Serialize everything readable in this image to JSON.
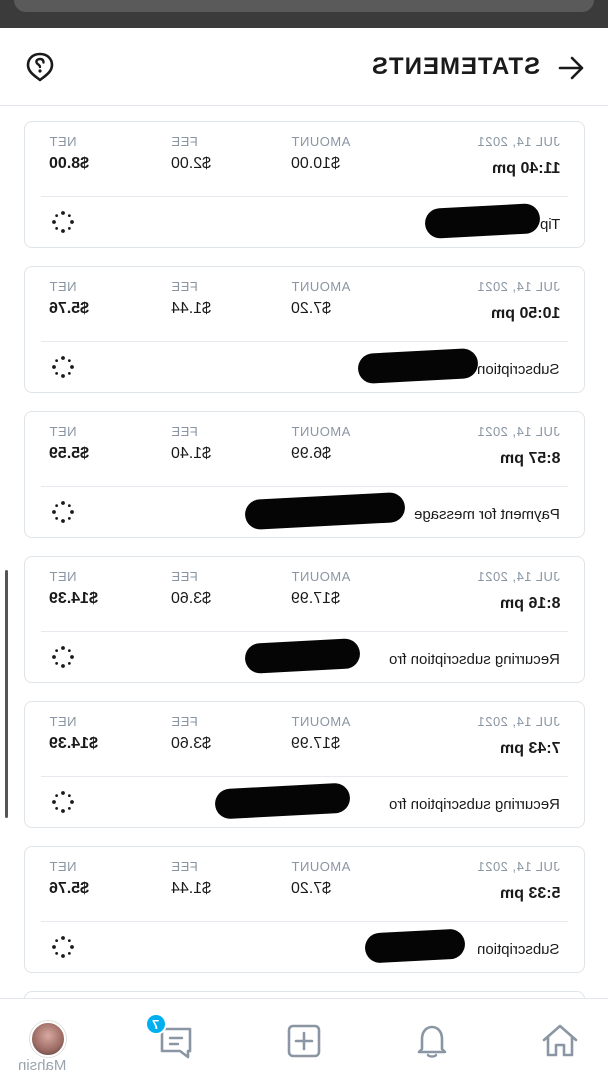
{
  "header": {
    "title": "STATEMENTS"
  },
  "labels": {
    "net": "NET",
    "fee": "FEE",
    "amount": "AMOUNT"
  },
  "transactions": [
    {
      "date": "JUL 14, 2021",
      "time": "11:40 pm",
      "amount": "$10.00",
      "fee": "$2.00",
      "net": "$8.00",
      "description": "Tip"
    },
    {
      "date": "JUL 14, 2021",
      "time": "10:50 pm",
      "amount": "$7.20",
      "fee": "$1.44",
      "net": "$5.76",
      "description": "Subscription"
    },
    {
      "date": "JUL 14, 2021",
      "time": "8:57 pm",
      "amount": "$6.99",
      "fee": "$1.40",
      "net": "$5.59",
      "description": "Payment for message"
    },
    {
      "date": "JUL 14, 2021",
      "time": "8:16 pm",
      "amount": "$17.99",
      "fee": "$3.60",
      "net": "$14.39",
      "description": "Recurring subscription fro"
    },
    {
      "date": "JUL 14, 2021",
      "time": "7:43 pm",
      "amount": "$17.99",
      "fee": "$3.60",
      "net": "$14.39",
      "description": "Recurring subscription fro"
    },
    {
      "date": "JUL 14, 2021",
      "time": "5:33 pm",
      "amount": "$7.20",
      "fee": "$1.44",
      "net": "$5.76",
      "description": "Subscription"
    }
  ],
  "bottom_nav": {
    "user_name": "Mahsin",
    "messages_badge": "7",
    "items": [
      "home-icon",
      "bell-icon",
      "add-post-icon",
      "messages-icon",
      "avatar"
    ]
  },
  "colors": {
    "accent": "#00aff0",
    "muted_text": "#8a96a3",
    "border": "#dfe4e9"
  }
}
